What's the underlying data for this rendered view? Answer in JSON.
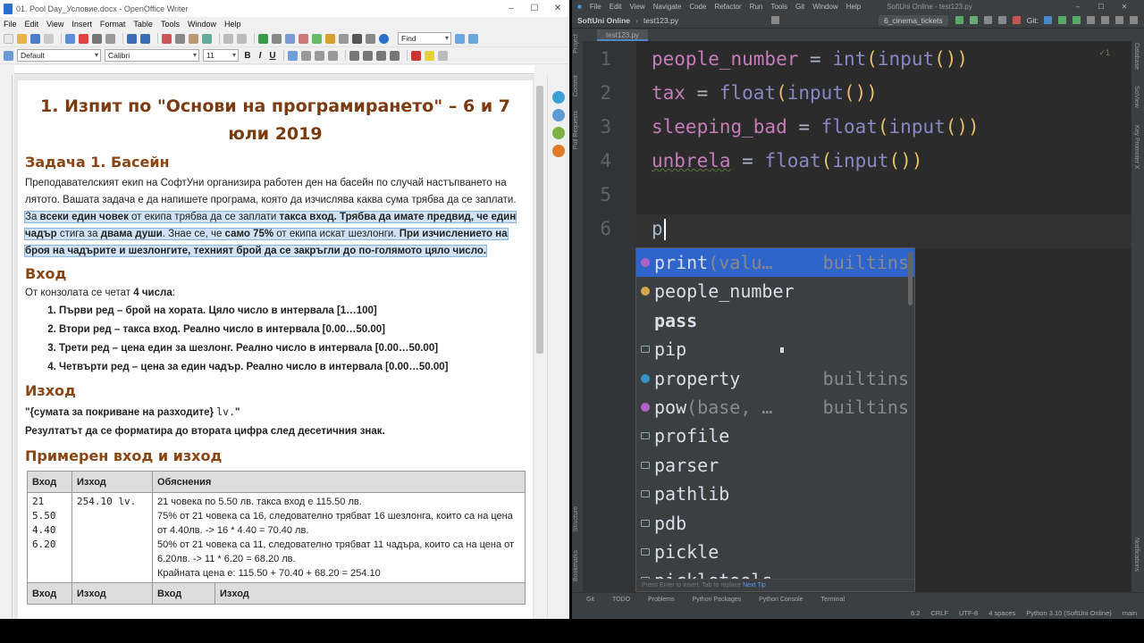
{
  "writer": {
    "title": "01. Pool Day_Условие.docx - OpenOffice Writer",
    "menu": [
      "File",
      "Edit",
      "View",
      "Insert",
      "Format",
      "Table",
      "Tools",
      "Window",
      "Help"
    ],
    "find_placeholder": "Find",
    "style_value": "Default",
    "font_value": "Calibri",
    "size_value": "11",
    "doc": {
      "h1": "1. Изпит по \"Основи на програмирането\" – 6 и 7 юли 2019",
      "task_title": "Задача 1. Басейн",
      "intro": "Преподавателският екип на СофтУни организира работен ден на басейн по случай настъпването на лятото. Вашата задача е да напишете програма, която да изчислява каква сума трябва да се заплати.",
      "sel_1": "За ",
      "sel_2": "всеки един човек",
      "sel_3": " от екипа трябва да се заплати ",
      "sel_4": "такса вход. Трябва да имате предвид, че един чадър",
      "sel_5": " стига за ",
      "sel_6": "двама души",
      "sel_7": ". Знае се, че ",
      "sel_8": "само 75%",
      "sel_9": " от екипа искат шезлонги. ",
      "sel_10": "При изчислението на броя на чадърите и шезлонгите, техният брой да се закръгли до по-голямото цяло число.",
      "input_title": "Вход",
      "input_intro_1": "От конзолата се четат ",
      "input_intro_2": "4 числа",
      "input_intro_3": ":",
      "input_items": [
        "Първи ред – брой на хората. Цяло число в интервала [1…100]",
        "Втори ред – такса вход. Реално число в интервала [0.00…50.00]",
        "Трети ред – цена един за шезлонг. Реално число в интервала [0.00…50.00]",
        "Четвърти ред – цена за един чадър. Реално число в интервала [0.00…50.00]"
      ],
      "output_title": "Изход",
      "output_fmt_1": "\"{сумата за покриване на разходите} ",
      "output_fmt_2": "lv.",
      "output_fmt_3": "\"",
      "output_note": "Резултатът да се форматира до втората цифра след десетичния знак.",
      "example_title": "Примерен вход и изход",
      "table": {
        "headers": [
          "Вход",
          "Изход",
          "Обяснения"
        ],
        "input_lines": [
          "21",
          "5.50",
          "4.40",
          "6.20"
        ],
        "output": "254.10 lv.",
        "explanations": [
          "21 човека по 5.50 лв. такса вход е 115.50 лв.",
          "75% от 21 човека са 16, следователно трябват 16 шезлонга, които са на цена от 4.40лв. -> 16 * 4.40 = 70.40 лв.",
          "50% от 21 човека са 11, следователно трябват 11 чадъра, които са на цена от 6.20лв. -> 11 * 6.20 = 68.20 лв.",
          "Крайната цена е: 115.50 + 70.40 + 68.20 = 254.10"
        ],
        "headers2": [
          "Вход",
          "Изход",
          "Вход",
          "Изход"
        ]
      }
    }
  },
  "ide": {
    "menu": [
      "File",
      "Edit",
      "View",
      "Navigate",
      "Code",
      "Refactor",
      "Run",
      "Tools",
      "Git",
      "Window",
      "Help"
    ],
    "window_title": "SoftUni Online - test123.py",
    "project": "SoftUni Online",
    "file": "test123.py",
    "run_config": "6_cinema_tickets",
    "git_label": "Git:",
    "tab": "test123.py",
    "left_tools": [
      "Project",
      "Commit",
      "Pull Requests"
    ],
    "left_tools_bottom": [
      "Structure",
      "Bookmarks"
    ],
    "right_tools": [
      "Database",
      "SciView",
      "Key Promoter X"
    ],
    "right_tools_bottom": [
      "Notifications"
    ],
    "line_numbers": [
      "1",
      "2",
      "3",
      "4",
      "5",
      "6"
    ],
    "code": {
      "l1_var": "people_number",
      "l1_op": " = ",
      "l1_fn1": "int",
      "l1_p1": "(",
      "l1_fn2": "input",
      "l1_p2": "()",
      "l1_p3": ")",
      "l2_var": "tax",
      "l2_op": " = ",
      "l2_fn1": "float",
      "l2_p1": "(",
      "l2_fn2": "input",
      "l2_p2": "()",
      "l2_p3": ")",
      "l3_var": "sleeping_bad",
      "l3_op": " = ",
      "l3_fn1": "float",
      "l3_p1": "(",
      "l3_fn2": "input",
      "l3_p2": "()",
      "l3_p3": ")",
      "l4_var": "unbrela",
      "l4_op": " = ",
      "l4_fn1": "float",
      "l4_p1": "(",
      "l4_fn2": "input",
      "l4_p2": "()",
      "l4_p3": ")",
      "l6": "p"
    },
    "check_mark": "✓1",
    "completion": [
      {
        "name": "print",
        "hint": "(valu…",
        "src": "builtins",
        "kind": "function"
      },
      {
        "name": "people_number",
        "hint": "",
        "src": "",
        "kind": "variable"
      },
      {
        "name": "pass",
        "hint": "",
        "src": "",
        "kind": "keyword"
      },
      {
        "name": "pip",
        "hint": "",
        "src": "",
        "kind": "module"
      },
      {
        "name": "property",
        "hint": "",
        "src": "builtins",
        "kind": "class"
      },
      {
        "name": "pow",
        "hint": "(base, …",
        "src": "builtins",
        "kind": "function"
      },
      {
        "name": "profile",
        "hint": "",
        "src": "",
        "kind": "module"
      },
      {
        "name": "parser",
        "hint": "",
        "src": "",
        "kind": "module"
      },
      {
        "name": "pathlib",
        "hint": "",
        "src": "",
        "kind": "module"
      },
      {
        "name": "pdb",
        "hint": "",
        "src": "",
        "kind": "module"
      },
      {
        "name": "pickle",
        "hint": "",
        "src": "",
        "kind": "module"
      },
      {
        "name": "pickletools",
        "hint": "",
        "src": "",
        "kind": "module"
      }
    ],
    "popup_footer": "Press Enter to insert, Tab to replace",
    "popup_footer_link": "Next Tip",
    "bottom_tools": [
      "Git",
      "TODO",
      "Problems",
      "Python Packages",
      "Python Console",
      "Terminal"
    ],
    "status": [
      "6:2",
      "CRLF",
      "UTF-8",
      "4 spaces",
      "Python 3.10 (SoftUni Online)",
      "main"
    ]
  },
  "colors": {
    "heading": "#7b3b0f",
    "selection": "#cfe2f3",
    "ide_bg": "#2b2b2b",
    "var_purple": "#c67cba",
    "builtin": "#8888c6"
  }
}
